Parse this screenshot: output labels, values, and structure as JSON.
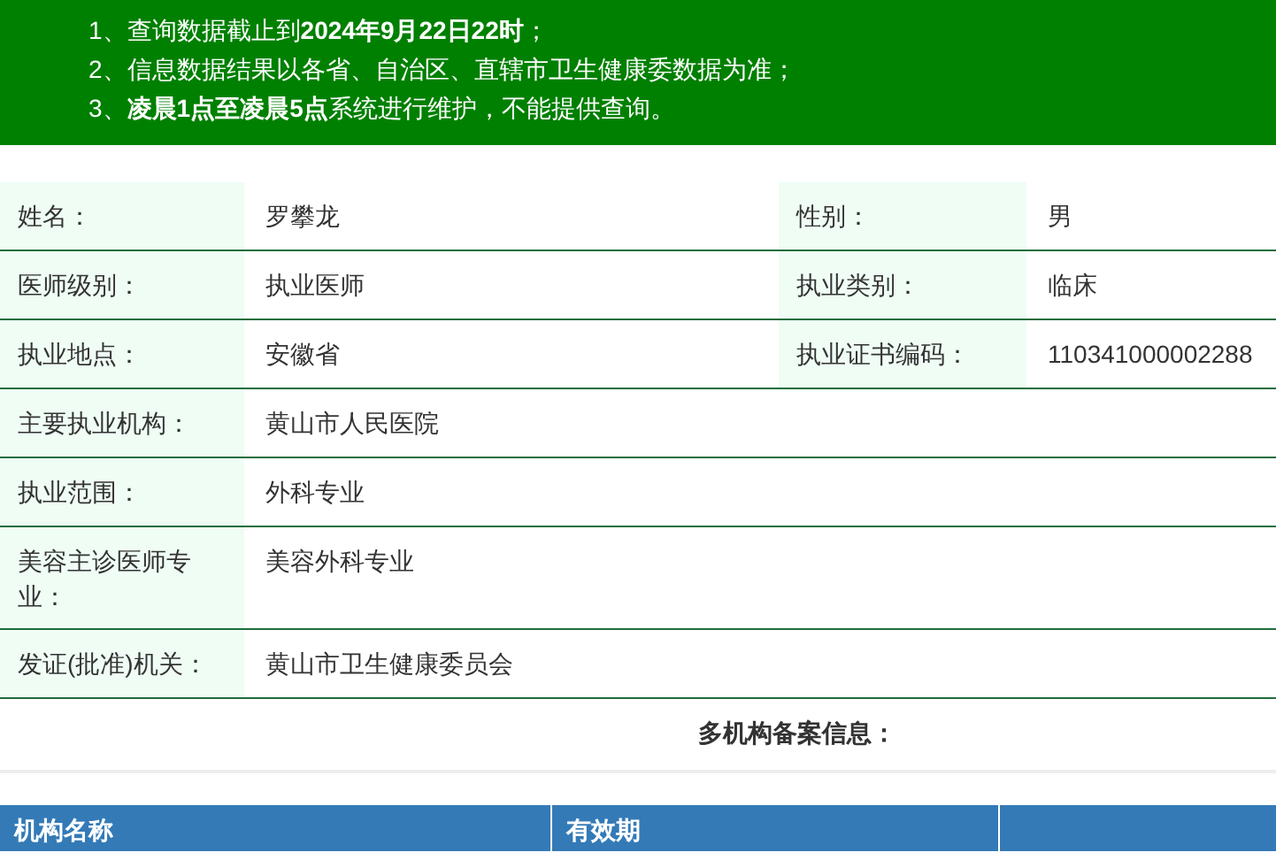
{
  "notice": {
    "items": [
      "1、查询数据截止到**2024年9月22日22时**；",
      "2、信息数据结果以各省、自治区、直辖市卫生健康委数据为准；",
      "3、**凌晨1点至凌晨5点**系统进行维护，不能提供查询。"
    ]
  },
  "info_table": {
    "rows": [
      {
        "cells": [
          {
            "label": "姓名：",
            "value": "罗攀龙"
          },
          {
            "label": "性别：",
            "value": "男"
          }
        ]
      },
      {
        "cells": [
          {
            "label": "医师级别：",
            "value": "执业医师"
          },
          {
            "label": "执业类别：",
            "value": "临床"
          }
        ]
      },
      {
        "cells": [
          {
            "label": "执业地点：",
            "value": "安徽省"
          },
          {
            "label": "执业证书编码：",
            "value": "110341000002288"
          }
        ]
      },
      {
        "cells": [
          {
            "label": "主要执业机构：",
            "value": "黄山市人民医院"
          }
        ]
      },
      {
        "cells": [
          {
            "label": "执业范围：",
            "value": "外科专业"
          }
        ]
      },
      {
        "cells": [
          {
            "label": "美容主诊医师专业：",
            "value": "美容外科专业"
          }
        ]
      },
      {
        "cells": [
          {
            "label": "发证(批准)机关：",
            "value": "黄山市卫生健康委员会"
          }
        ]
      }
    ]
  },
  "section_title": "多机构备案信息：",
  "institution_table": {
    "columns": [
      "机构名称",
      "有效期"
    ]
  }
}
